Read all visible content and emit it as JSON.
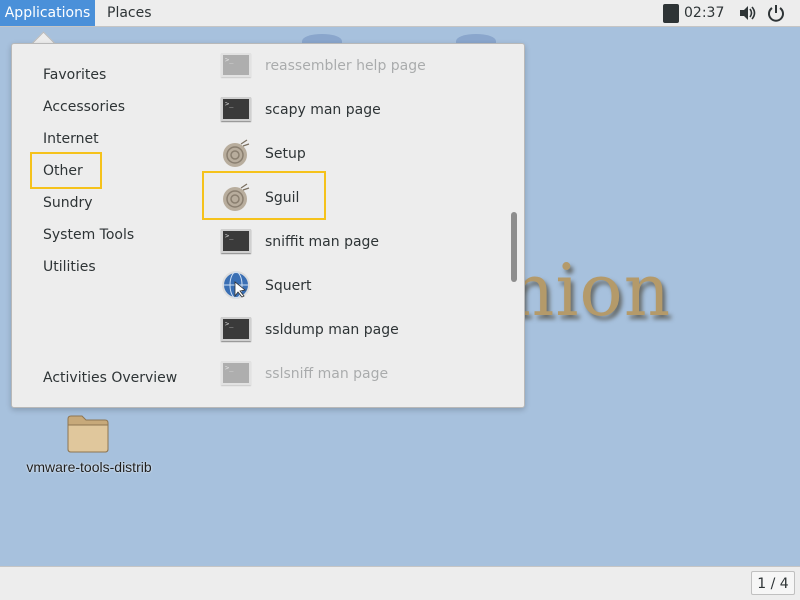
{
  "topbar": {
    "applications_label": "Applications",
    "places_label": "Places",
    "clock": "02:37",
    "volume_icon": "volume-icon",
    "power_icon": "power-icon"
  },
  "desktop": {
    "wallpaper_text": "nion",
    "folder_label": "vmware-tools-distrib"
  },
  "menu": {
    "categories": [
      {
        "label": "Favorites"
      },
      {
        "label": "Accessories"
      },
      {
        "label": "Internet"
      },
      {
        "label": "Other"
      },
      {
        "label": "Sundry"
      },
      {
        "label": "System Tools"
      },
      {
        "label": "Utilities"
      }
    ],
    "activities_overview": "Activities Overview",
    "apps": [
      {
        "label": "reassembler help page",
        "icon": "terminal-icon"
      },
      {
        "label": "scapy man page",
        "icon": "terminal-icon"
      },
      {
        "label": "Setup",
        "icon": "onion-icon"
      },
      {
        "label": "Sguil",
        "icon": "onion-icon"
      },
      {
        "label": "sniffit man page",
        "icon": "terminal-icon"
      },
      {
        "label": "Squert",
        "icon": "globe-icon"
      },
      {
        "label": "ssldump man page",
        "icon": "terminal-icon"
      },
      {
        "label": "sslsniff man page",
        "icon": "terminal-icon"
      }
    ],
    "selected_category": "Other",
    "highlighted_app": "Sguil"
  },
  "bottombar": {
    "workspace_indicator": "1 / 4"
  },
  "colors": {
    "accent": "#4a90d9",
    "highlight_box": "#f5c21b",
    "desktop_bg": "#a7c1dd"
  }
}
